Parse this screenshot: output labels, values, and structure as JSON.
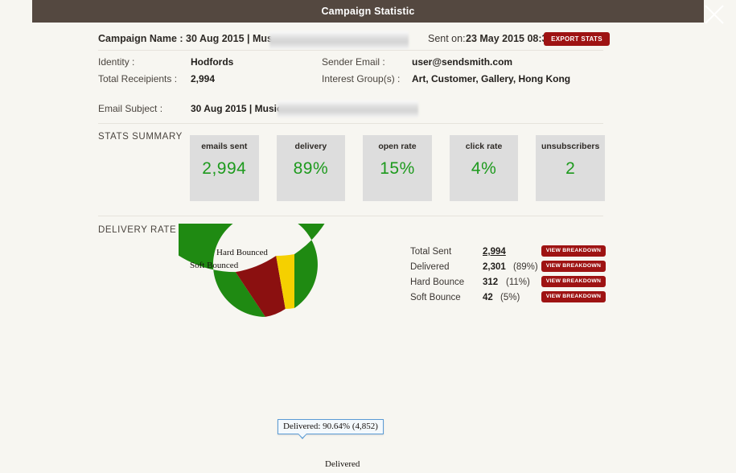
{
  "window": {
    "title": "Campaign Statistic",
    "close_icon": "close-x-icon"
  },
  "campaign": {
    "name_label": "Campaign Name : 30 Aug 2015 | Music",
    "sent_on_label": "Sent on:",
    "sent_on_value": "23 May 2015 08:38",
    "export_button": "EXPORT STATS",
    "details": {
      "identity_label": "Identity :",
      "identity_value": "Hodfords",
      "recipients_label": "Total Receipients :",
      "recipients_value": "2,994",
      "sender_email_label": "Sender Email :",
      "sender_email_value": "user@sendsmith.com",
      "interest_groups_label": "Interest Group(s) :",
      "interest_groups_value": "Art, Customer, Gallery, Hong Kong",
      "subject_label": "Email Subject :",
      "subject_value": "30 Aug 2015 | Music"
    }
  },
  "stats_summary": {
    "heading": "STATS SUMMARY",
    "cards": [
      {
        "label": "emails sent",
        "value": "2,994"
      },
      {
        "label": "delivery",
        "value": "89%"
      },
      {
        "label": "open rate",
        "value": "15%"
      },
      {
        "label": "click rate",
        "value": "4%"
      },
      {
        "label": "unsubscribers",
        "value": "2"
      }
    ],
    "value_color": "#1d9a1d"
  },
  "delivery_rate": {
    "heading": "DELIVERY RATE",
    "breakdown": {
      "button_label": "VIEW BREAKDOWN",
      "rows": [
        {
          "label": "Total Sent",
          "value": "2,994",
          "percent": ""
        },
        {
          "label": "Delivered",
          "value": "2,301",
          "percent": "(89%)"
        },
        {
          "label": "Hard Bounce",
          "value": "312",
          "percent": "(11%)"
        },
        {
          "label": "Soft Bounce",
          "value": "42",
          "percent": "(5%)"
        }
      ]
    },
    "callouts": {
      "hard_bounced": "Hard Bounced",
      "soft_bounced": "Soft Bounced",
      "delivered": "Delivered"
    },
    "tooltip": "Delivered: 90.64% (4,852)"
  },
  "chart_data": {
    "type": "pie",
    "title": "DELIVERY RATE",
    "subtype": "donut",
    "categories": [
      "Delivered",
      "Hard Bounced",
      "Soft Bounced"
    ],
    "values": [
      90.64,
      6.6,
      2.76
    ],
    "counts": [
      4852,
      312,
      42
    ],
    "colors": [
      "#1f8a12",
      "#8b1010",
      "#f5d000"
    ],
    "labels_shown": [
      "Delivered",
      "Hard Bounced",
      "Soft Bounced"
    ],
    "annotations": [
      "Delivered: 90.64% (4,852)"
    ],
    "legend": "none",
    "inner_radius_ratio": 0.5,
    "start_angle_deg": 90,
    "direction": "counterclockwise"
  },
  "colors": {
    "titlebar": "#544840",
    "page_bg": "#f7f6f1",
    "accent_red": "#9e1313",
    "green": "#1f8a12",
    "dark_red": "#8b1010",
    "yellow": "#f5d000",
    "card_gray": "#dddddd"
  }
}
